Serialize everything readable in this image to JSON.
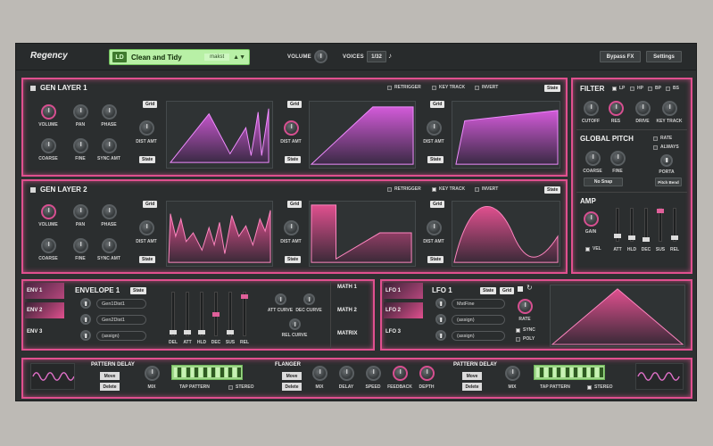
{
  "app": {
    "title": "Regency"
  },
  "header": {
    "preset_badge": "LD",
    "preset_name": "Clean and Tidy",
    "preset_author": "makst",
    "volume_label": "VOLUME",
    "voices_label": "VOICES",
    "voices_value": "1/32",
    "bypass_fx": "Bypass FX",
    "settings": "Settings"
  },
  "gen_layers": [
    {
      "title": "GEN LAYER 1",
      "retrigger": "RETRIGGER",
      "key_track": "KEY TRACK",
      "invert": "INVERT",
      "state": "State",
      "knobs": [
        "VOLUME",
        "PAN",
        "PHASE",
        "COARSE",
        "FINE",
        "SYNC AMT"
      ],
      "slots": [
        {
          "grid": "Grid",
          "dist": "DIST AMT",
          "state": "State"
        },
        {
          "grid": "Grid",
          "dist": "DIST AMT",
          "state": "State"
        },
        {
          "grid": "Grid",
          "dist": "DIST AMT",
          "state": "State"
        }
      ]
    },
    {
      "title": "GEN LAYER 2",
      "retrigger": "RETRIGGER",
      "key_track": "KEY TRACK",
      "invert": "INVERT",
      "state": "State",
      "knobs": [
        "VOLUME",
        "PAN",
        "PHASE",
        "COARSE",
        "FINE",
        "SYNC AMT"
      ],
      "slots": [
        {
          "grid": "Grid",
          "dist": "DIST AMT",
          "state": "State"
        },
        {
          "grid": "Grid",
          "dist": "DIST AMT",
          "state": "State"
        },
        {
          "grid": "Grid",
          "dist": "DIST AMT",
          "state": "State"
        }
      ]
    }
  ],
  "filter": {
    "title": "FILTER",
    "modes": [
      "LP",
      "HP",
      "BP",
      "BS"
    ],
    "knobs": [
      "CUTOFF",
      "RES",
      "DRIVE",
      "KEY TRACK"
    ]
  },
  "global_pitch": {
    "title": "GLOBAL PITCH",
    "rate": "RATE",
    "always": "ALWAYS",
    "knobs": [
      "COARSE",
      "FINE",
      "PORTA"
    ],
    "snap": "No Snap",
    "pitch_bend": "Pitch Bend"
  },
  "amp": {
    "title": "AMP",
    "gain": "GAIN",
    "vel": "VEL",
    "faders": [
      "ATT",
      "HLD",
      "DEC",
      "SUS",
      "REL"
    ]
  },
  "envelope": {
    "tabs": [
      "ENV 1",
      "ENV 2",
      "ENV 3"
    ],
    "title": "ENVELOPE 1",
    "state": "State",
    "targets": [
      "Gen1Dist1",
      "Gen2Dist1",
      "(assign)"
    ],
    "faders": [
      "DEL",
      "ATT",
      "HLD",
      "DEC",
      "SUS",
      "REL"
    ],
    "curves": [
      "ATT CURVE",
      "DEC CURVE",
      "REL CURVE"
    ],
    "math": [
      "MATH 1",
      "MATH 2",
      "MATRIX"
    ]
  },
  "lfo": {
    "tabs": [
      "LFO 1",
      "LFO 2",
      "LFO 3"
    ],
    "title": "LFO 1",
    "state": "State",
    "grid": "Grid",
    "targets": [
      "MstFine",
      "(assign)",
      "(assign)"
    ],
    "rate": "RATE",
    "sync": "SYNC",
    "poly": "POLY"
  },
  "fx": {
    "pattern_delay_1": {
      "title": "PATTERN DELAY",
      "move": "Move",
      "delete": "Delete",
      "mix": "MIX",
      "tap": "TAP PATTERN",
      "stereo": "STEREO"
    },
    "flanger": {
      "title": "FLANGER",
      "move": "Move",
      "delete": "Delete",
      "knobs": [
        "MIX",
        "DELAY",
        "SPEED",
        "FEEDBACK",
        "DEPTH"
      ]
    },
    "pattern_delay_2": {
      "title": "PATTERN DELAY",
      "move": "Move",
      "delete": "Delete",
      "mix": "MIX",
      "tap": "TAP PATTERN",
      "stereo": "STEREO"
    }
  },
  "colors": {
    "accent": "#e0508f",
    "panel": "#2b2e2f",
    "preset_green": "#b8f0a6"
  }
}
